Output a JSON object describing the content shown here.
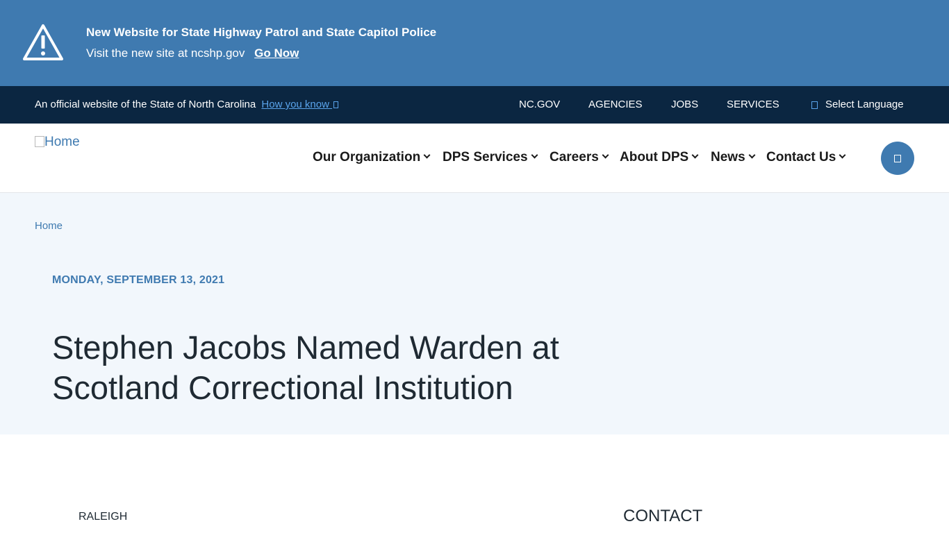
{
  "alert": {
    "icon": "warning-triangle-icon",
    "title": "New Website for State Highway Patrol and State Capitol Police",
    "text": "Visit the new site at ncshp.gov",
    "link_label": "Go Now"
  },
  "official_bar": {
    "text": "An official website of the State of North Carolina",
    "how_link": "How you know",
    "links": [
      "NC.GOV",
      "AGENCIES",
      "JOBS",
      "SERVICES"
    ],
    "language_label": "Select Language"
  },
  "header": {
    "logo_alt": "Home",
    "nav": [
      "Our Organization",
      "DPS Services",
      "Careers",
      "About DPS",
      "News",
      "Contact Us"
    ]
  },
  "hero": {
    "breadcrumb": "Home",
    "date": "MONDAY, SEPTEMBER 13, 2021",
    "title": "Stephen Jacobs Named Warden at Scotland Correctional Institution"
  },
  "article": {
    "dateline": "RALEIGH",
    "sidebar_heading": "CONTACT"
  },
  "colors": {
    "alert_bg": "#3f7ab0",
    "official_bg": "#0b2641",
    "hero_bg": "#f2f7fc",
    "accent": "#3f7ab0"
  }
}
